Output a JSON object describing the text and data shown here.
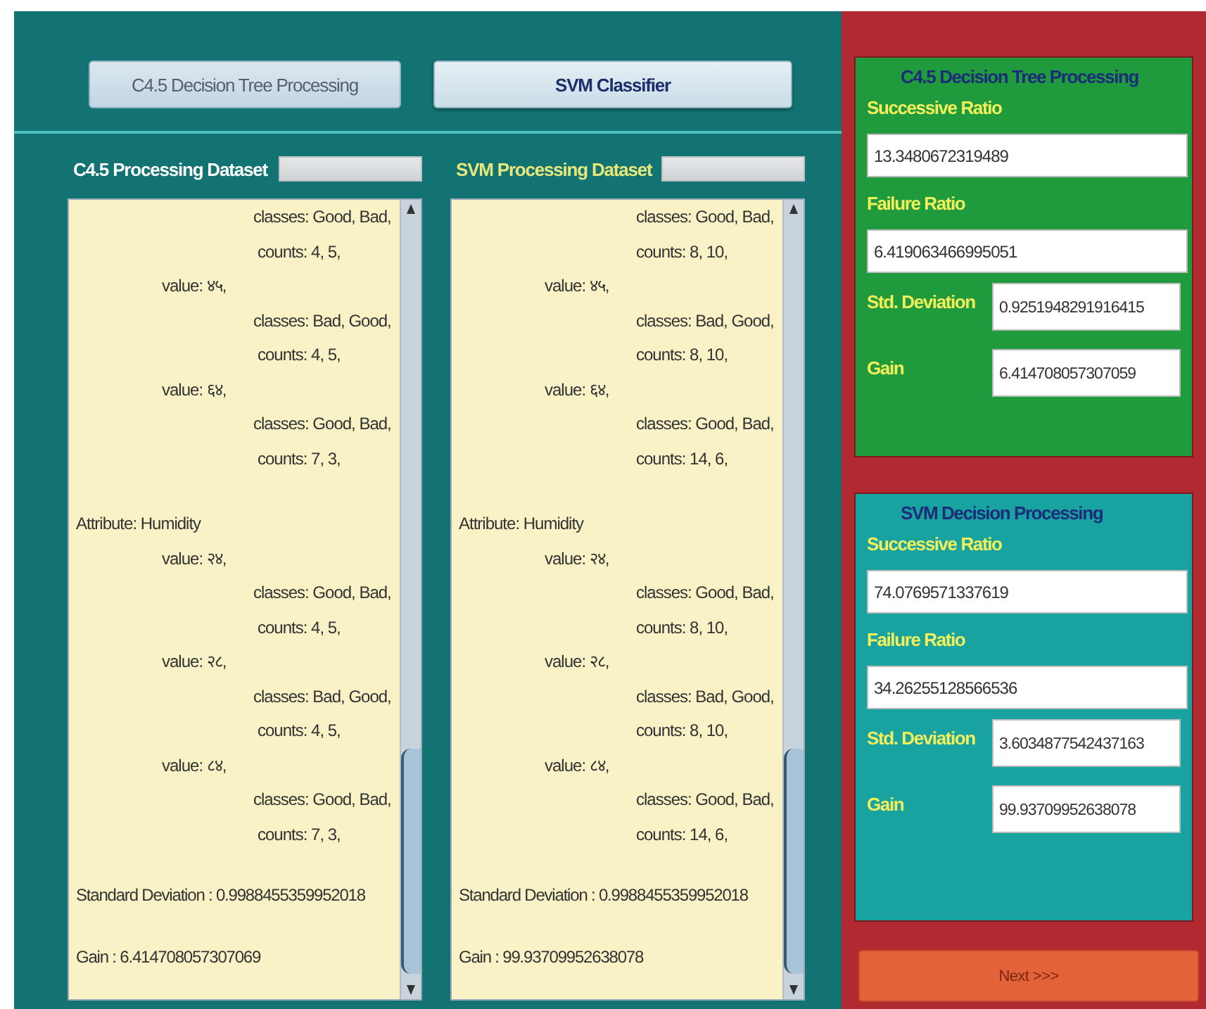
{
  "toolbar": {
    "buttons": [
      {
        "label": "C4.5 Decision Tree Processing",
        "selected": false
      },
      {
        "label": "SVM Classifier",
        "selected": true
      }
    ]
  },
  "datasets": [
    {
      "title": "C4.5 Processing Dataset",
      "selected": false,
      "lines": [
        {
          "kind": "classes",
          "text": "classes: Good, Bad,"
        },
        {
          "kind": "counts",
          "text": "counts: 4, 5,"
        },
        {
          "kind": "value",
          "text": "value: ४५,"
        },
        {
          "kind": "classes",
          "text": "classes: Bad, Good,"
        },
        {
          "kind": "counts",
          "text": "counts: 4, 5,"
        },
        {
          "kind": "value",
          "text": "value: ६४,"
        },
        {
          "kind": "classes",
          "text": "classes: Good, Bad,"
        },
        {
          "kind": "counts",
          "text": "counts: 7, 3,"
        },
        {
          "kind": "attribute",
          "text": "Attribute: Humidity"
        },
        {
          "kind": "value",
          "text": "value: २४,"
        },
        {
          "kind": "classes",
          "text": "classes: Good, Bad,"
        },
        {
          "kind": "counts",
          "text": "counts: 4, 5,"
        },
        {
          "kind": "value",
          "text": "value: २८,"
        },
        {
          "kind": "classes",
          "text": "classes: Bad, Good,"
        },
        {
          "kind": "counts",
          "text": "counts: 4, 5,"
        },
        {
          "kind": "value",
          "text": "value: ८४,"
        },
        {
          "kind": "classes",
          "text": "classes: Good, Bad,"
        },
        {
          "kind": "counts",
          "text": "counts: 7, 3,"
        },
        {
          "kind": "stat",
          "text": "Standard Deviation : 0.9988455359952018"
        },
        {
          "kind": "stat",
          "text": "Gain : 6.414708057307069"
        }
      ]
    },
    {
      "title": "SVM Processing Dataset",
      "selected": true,
      "lines": [
        {
          "kind": "classes",
          "text": "classes: Good, Bad,"
        },
        {
          "kind": "classes",
          "text": "counts: 8, 10,"
        },
        {
          "kind": "value",
          "text": "value: ४५,"
        },
        {
          "kind": "classes",
          "text": "classes: Bad, Good,"
        },
        {
          "kind": "classes",
          "text": "counts: 8, 10,"
        },
        {
          "kind": "value",
          "text": "value: ६४,"
        },
        {
          "kind": "classes",
          "text": "classes: Good, Bad,"
        },
        {
          "kind": "classes",
          "text": "counts: 14, 6,"
        },
        {
          "kind": "attribute",
          "text": "Attribute: Humidity"
        },
        {
          "kind": "value",
          "text": "value: २४,"
        },
        {
          "kind": "classes",
          "text": "classes: Good, Bad,"
        },
        {
          "kind": "classes",
          "text": "counts: 8, 10,"
        },
        {
          "kind": "value",
          "text": "value: २८,"
        },
        {
          "kind": "classes",
          "text": "classes: Bad, Good,"
        },
        {
          "kind": "classes",
          "text": "counts: 8, 10,"
        },
        {
          "kind": "value",
          "text": "value: ८४,"
        },
        {
          "kind": "classes",
          "text": "classes: Good, Bad,"
        },
        {
          "kind": "classes",
          "text": "counts: 14, 6,"
        },
        {
          "kind": "stat",
          "text": "Standard Deviation : 0.9988455359952018"
        },
        {
          "kind": "stat",
          "text": "Gain : 99.93709952638078"
        }
      ]
    }
  ],
  "results": [
    {
      "title": "C4.5 Decision Tree Processing",
      "color": "#1f9b3e",
      "fields": [
        {
          "kind": "wide",
          "label": "Successive Ratio",
          "value": "13.3480672319489"
        },
        {
          "kind": "wide",
          "label": "Failure Ratio",
          "value": "6.419063466995051"
        },
        {
          "kind": "inline",
          "label": "Std. Deviation",
          "value": "0.9251948291916415"
        },
        {
          "kind": "inline",
          "label": "Gain",
          "value": "6.414708057307059"
        }
      ]
    },
    {
      "title": "SVM Decision Processing",
      "color": "#18a3a1",
      "fields": [
        {
          "kind": "wide",
          "label": "Successive Ratio",
          "value": "74.0769571337619"
        },
        {
          "kind": "wide",
          "label": "Failure Ratio",
          "value": "34.26255128566536"
        },
        {
          "kind": "inline",
          "label": "Std. Deviation",
          "value": "3.6034877542437163"
        },
        {
          "kind": "inline",
          "label": "Gain",
          "value": "99.93709952638078"
        }
      ]
    }
  ],
  "next_button": {
    "label": "Next >>>"
  }
}
